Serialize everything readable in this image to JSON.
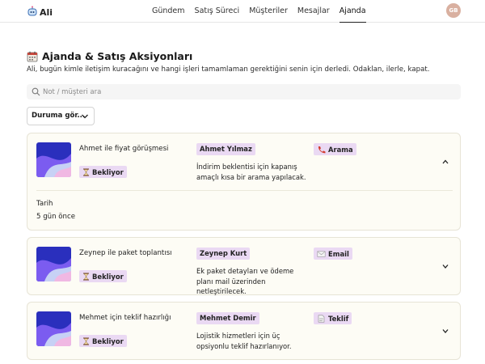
{
  "app": {
    "logo_text": "Ali"
  },
  "nav": {
    "items": [
      {
        "label": "Gündem",
        "active": false
      },
      {
        "label": "Satış Süreci",
        "active": false
      },
      {
        "label": "Müşteriler",
        "active": false
      },
      {
        "label": "Mesajlar",
        "active": false
      },
      {
        "label": "Ajanda",
        "active": true
      }
    ]
  },
  "user": {
    "initials": "GB"
  },
  "header": {
    "title": "Ajanda & Satış Aksiyonları",
    "subtitle": "Ali, bugün kimle iletişim kuracağını ve hangi işleri tamamlaman gerektiğini senin için derledi. Odaklan, ilerle, kapat."
  },
  "search": {
    "placeholder": "Not / müşteri ara",
    "value": ""
  },
  "filter": {
    "label": "Duruma gör..."
  },
  "tasks": [
    {
      "title": "Ahmet ile fiyat görüşmesi",
      "status": "Bekliyor",
      "person": "Ahmet Yılmaz",
      "description": "İndirim beklentisi için kapanış amaçlı kısa bir arama yapılacak.",
      "type": "Arama",
      "type_icon": "phone-icon",
      "expanded": true,
      "date_label": "Tarih",
      "date_value": "5 gün önce"
    },
    {
      "title": "Zeynep ile paket toplantısı",
      "status": "Bekliyor",
      "person": "Zeynep Kurt",
      "description": "Ek paket detayları ve ödeme planı mail üzerinden netleştirilecek.",
      "type": "Email",
      "type_icon": "envelope-icon",
      "expanded": false
    },
    {
      "title": "Mehmet için teklif hazırlığı",
      "status": "Bekliyor",
      "person": "Mehmet Demir",
      "description": "Lojistik hizmetleri için üç opsiyonlu teklif hazırlanıyor.",
      "type": "Teklif",
      "type_icon": "document-icon",
      "expanded": false
    }
  ],
  "colors": {
    "chip_bg": "#ead9f3",
    "card_bg": "#fdfcf5",
    "card_border": "#e7e4d6",
    "avatar_bg": "#d9b0a0"
  }
}
